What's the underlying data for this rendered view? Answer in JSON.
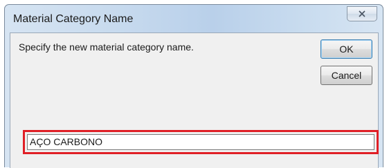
{
  "dialog": {
    "title": "Material Category Name",
    "close_icon": "close-x-icon",
    "prompt": "Specify the new material category name.",
    "ok_label": "OK",
    "cancel_label": "Cancel",
    "name_value": "AÇO CARBONO",
    "highlight_color": "#e01f26"
  }
}
